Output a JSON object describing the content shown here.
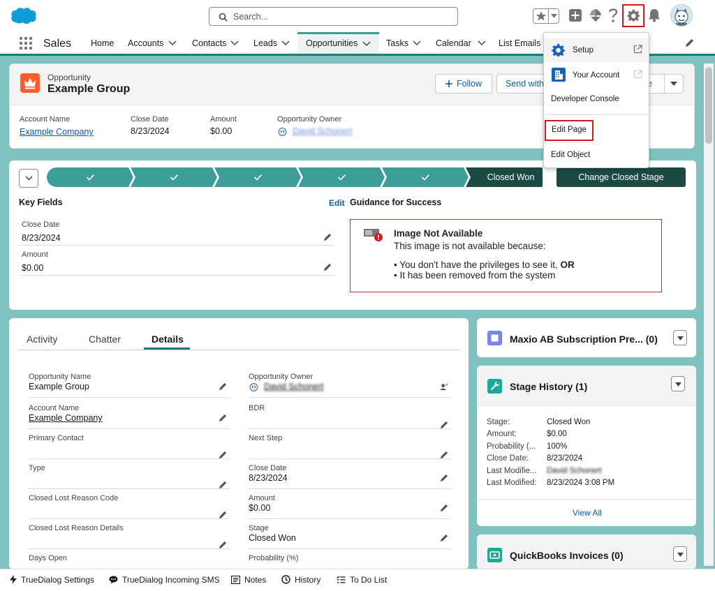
{
  "colors": {
    "brand_teal": "#1b7d76",
    "path_done": "#3d9e97",
    "path_current": "#1b4a44",
    "link": "#0b5cab",
    "highlight_red": "#d61a1a",
    "opportunity_icon": "#ff5d2d"
  },
  "header": {
    "search_placeholder": "Search..."
  },
  "nav": {
    "app_name": "Sales",
    "items": [
      {
        "label": "Home"
      },
      {
        "label": "Accounts"
      },
      {
        "label": "Contacts"
      },
      {
        "label": "Leads"
      },
      {
        "label": "Opportunities"
      },
      {
        "label": "Tasks"
      },
      {
        "label": "Calendar"
      },
      {
        "label": "List Emails"
      }
    ]
  },
  "record": {
    "type_label": "Opportunity",
    "name": "Example Group",
    "buttons": {
      "follow": "Follow",
      "send_with": "Send with",
      "clone_partial": "e"
    },
    "highlights": [
      {
        "label": "Account Name",
        "value": "Example Company"
      },
      {
        "label": "Close Date",
        "value": "8/23/2024"
      },
      {
        "label": "Amount",
        "value": "$0.00"
      },
      {
        "label": "Opportunity Owner",
        "value": "David Schonert"
      }
    ]
  },
  "path": {
    "stages_completed_count": 5,
    "current_stage": "Closed Won",
    "change_button": "Change Closed Stage"
  },
  "key_fields": {
    "title": "Key Fields",
    "edit_label": "Edit",
    "fields": [
      {
        "label": "Close Date",
        "value": "8/23/2024"
      },
      {
        "label": "Amount",
        "value": "$0.00"
      }
    ]
  },
  "guidance": {
    "title": "Guidance for Success",
    "image_title": "Image Not Available",
    "image_text": "This image is not available because:",
    "bullet1_a": "You don't have the privileges to see it,",
    "bullet1_b": "OR",
    "bullet2": "It has been removed from the system"
  },
  "details": {
    "tabs": [
      "Activity",
      "Chatter",
      "Details"
    ],
    "active_tab": "Details",
    "left": [
      {
        "label": "Opportunity Name",
        "value": "Example Group"
      },
      {
        "label": "Account Name",
        "value": "Example Company"
      },
      {
        "label": "Primary Contact",
        "value": ""
      },
      {
        "label": "Type",
        "value": ""
      },
      {
        "label": "Closed Lost Reason Code",
        "value": ""
      },
      {
        "label": "Closed Lost Reason Details",
        "value": ""
      },
      {
        "label": "Days Open",
        "value": ""
      }
    ],
    "right": [
      {
        "label": "Opportunity Owner",
        "value": "David Schonert"
      },
      {
        "label": "BDR",
        "value": ""
      },
      {
        "label": "Next Step",
        "value": ""
      },
      {
        "label": "Close Date",
        "value": "8/23/2024"
      },
      {
        "label": "Amount",
        "value": "$0.00"
      },
      {
        "label": "Stage",
        "value": "Closed Won"
      },
      {
        "label": "Probability (%)",
        "value": ""
      }
    ]
  },
  "maxio_card": {
    "title": "Maxio AB Subscription Pre...",
    "count": "(0)"
  },
  "stage_history": {
    "title": "Stage History",
    "count": "(1)",
    "rows": [
      {
        "label": "Stage:",
        "value": "Closed Won"
      },
      {
        "label": "Amount:",
        "value": "$0.00"
      },
      {
        "label": "Probability (...",
        "value": "100%"
      },
      {
        "label": "Close Date:",
        "value": "8/23/2024"
      },
      {
        "label": "Last Modifie...",
        "value": "David Schonert"
      },
      {
        "label": "Last Modified:",
        "value": "8/23/2024 3:08 PM"
      }
    ],
    "view_all": "View All"
  },
  "quickbooks_card": {
    "title": "QuickBooks Invoices",
    "count": "(0)"
  },
  "setup_menu": {
    "setup": "Setup",
    "your_account": "Your Account",
    "developer_console": "Developer Console",
    "edit_page": "Edit Page",
    "edit_object": "Edit Object"
  },
  "utility_bar": {
    "items": [
      "TrueDialog Settings",
      "TrueDialog Incoming SMS",
      "Notes",
      "History",
      "To Do List"
    ]
  }
}
